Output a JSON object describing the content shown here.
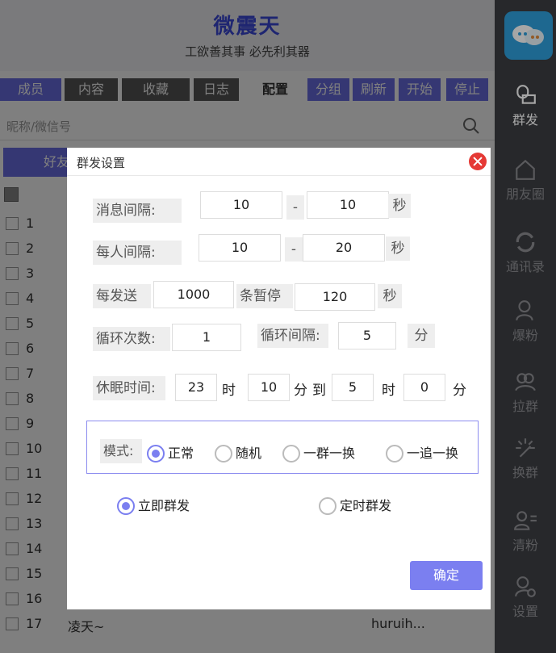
{
  "header": {
    "title": "微震天",
    "subtitle": "工欲善其事 必先利其器"
  },
  "tabs": [
    "成员",
    "内容",
    "收藏",
    "日志",
    "配置",
    "分组",
    "刷新",
    "开始",
    "停止"
  ],
  "search": {
    "placeholder": "昵称/微信号"
  },
  "friends_button": "好友",
  "rows": [
    {
      "num": "1",
      "nick": "",
      "wx": ""
    },
    {
      "num": "2",
      "nick": "",
      "wx": ""
    },
    {
      "num": "3",
      "nick": "",
      "wx": ""
    },
    {
      "num": "4",
      "nick": "",
      "wx": ""
    },
    {
      "num": "5",
      "nick": "",
      "wx": ""
    },
    {
      "num": "6",
      "nick": "",
      "wx": ""
    },
    {
      "num": "7",
      "nick": "",
      "wx": ""
    },
    {
      "num": "8",
      "nick": "",
      "wx": ""
    },
    {
      "num": "9",
      "nick": "",
      "wx": ""
    },
    {
      "num": "10",
      "nick": "",
      "wx": ""
    },
    {
      "num": "11",
      "nick": "",
      "wx": ""
    },
    {
      "num": "12",
      "nick": "",
      "wx": ""
    },
    {
      "num": "13",
      "nick": "",
      "wx": ""
    },
    {
      "num": "14",
      "nick": "",
      "wx": ""
    },
    {
      "num": "15",
      "nick": "",
      "wx": ""
    },
    {
      "num": "16",
      "nick": "",
      "wx": ""
    },
    {
      "num": "17",
      "nick": "凌天~",
      "wx": "huruih..."
    }
  ],
  "sidebar": {
    "items": [
      {
        "label": "群发",
        "icon": "group-send-icon"
      },
      {
        "label": "朋友圈",
        "icon": "home-icon"
      },
      {
        "label": "通讯录",
        "icon": "refresh-icon"
      },
      {
        "label": "爆粉",
        "icon": "user-add-icon"
      },
      {
        "label": "拉群",
        "icon": "group-icon"
      },
      {
        "label": "换群",
        "icon": "sparkle-icon"
      },
      {
        "label": "清粉",
        "icon": "user-list-icon"
      },
      {
        "label": "设置",
        "icon": "settings-icon"
      }
    ]
  },
  "dialog": {
    "title": "群发设置",
    "msg_interval": {
      "label": "消息间隔:",
      "min": "10",
      "dash": "-",
      "max": "10",
      "unit": "秒"
    },
    "person_interval": {
      "label": "每人间隔:",
      "min": "10",
      "dash": "-",
      "max": "20",
      "unit": "秒"
    },
    "per_send": {
      "label": "每发送",
      "count": "1000",
      "pause_label": "条暂停",
      "pause": "120",
      "unit": "秒"
    },
    "loop": {
      "count_label": "循环次数:",
      "count": "1",
      "interval_label": "循环间隔:",
      "interval": "5",
      "unit": "分"
    },
    "sleep": {
      "label": "休眠时间:",
      "from_h": "23",
      "h1": "时",
      "from_m": "10",
      "m1": "分",
      "to": "到",
      "to_h": "5",
      "h2": "时",
      "to_m": "0",
      "m2": "分"
    },
    "mode": {
      "label": "模式:",
      "options": [
        "正常",
        "随机",
        "一群一换",
        "一追一换"
      ],
      "selected": "正常"
    },
    "send_type": {
      "options": [
        "立即群发",
        "定时群发"
      ],
      "selected": "立即群发"
    },
    "ok": "确定"
  }
}
